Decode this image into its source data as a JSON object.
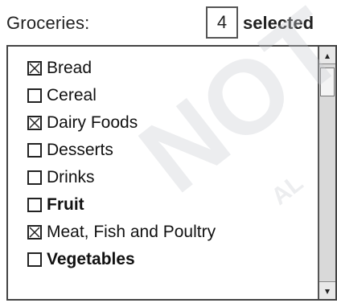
{
  "header": {
    "groceries_label": "Groceries:",
    "selected_count": "4",
    "selected_label": "selected"
  },
  "list": {
    "items": [
      {
        "label": "Bread",
        "checked": true
      },
      {
        "label": "Cereal",
        "checked": false
      },
      {
        "label": "Dairy Foods",
        "checked": true
      },
      {
        "label": "Desserts",
        "checked": false
      },
      {
        "label": "Drinks",
        "checked": false
      },
      {
        "label": "Fruit",
        "checked": false
      },
      {
        "label": "Meat, Fish and Poultry",
        "checked": true
      },
      {
        "label": "Vegetables",
        "checked": false
      }
    ]
  },
  "scrollbar": {
    "up_icon": "arrow-up-icon",
    "down_icon": "arrow-down-icon"
  },
  "watermark": {
    "text": "NOT F",
    "text2": "AL"
  }
}
